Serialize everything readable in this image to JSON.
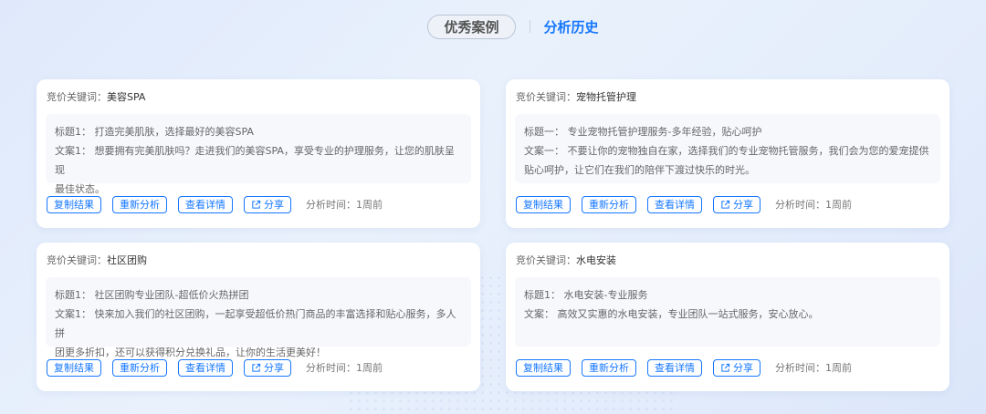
{
  "tabs": {
    "excellent_cases": "优秀案例",
    "analysis_history": "分析历史"
  },
  "cards": [
    {
      "keyword_label": "竞价关键词：",
      "keyword": "美容SPA",
      "title_label": "标题1：",
      "title": "打造完美肌肤，选择最好的美容SPA",
      "copy_label": "文案1：",
      "copy_line1": "想要拥有完美肌肤吗？走进我们的美容SPA，享受专业的护理服务，让您的肌肤呈现",
      "copy_line2": "最佳状态。",
      "copy_btn": "复制结果",
      "reanalyze_btn": "重新分析",
      "details_btn": "查看详情",
      "share_btn": "分享",
      "time": "分析时间：1周前"
    },
    {
      "keyword_label": "竞价关键词：",
      "keyword": "宠物托管护理",
      "title_label": "标题一：",
      "title": "专业宠物托管护理服务-多年经验，贴心呵护",
      "copy_label": "文案一：",
      "copy_line1": "不要让你的宠物独自在家，选择我们的专业宠物托管服务，我们会为您的爱宠提供",
      "copy_line2": "贴心呵护，让它们在我们的陪伴下渡过快乐的时光。",
      "copy_btn": "复制结果",
      "reanalyze_btn": "重新分析",
      "details_btn": "查看详情",
      "share_btn": "分享",
      "time": "分析时间：1周前"
    },
    {
      "keyword_label": "竞价关键词：",
      "keyword": "社区团购",
      "title_label": "标题1：",
      "title": "社区团购专业团队-超低价火热拼团",
      "copy_label": "文案1：",
      "copy_line1": "快来加入我们的社区团购，一起享受超低价热门商品的丰富选择和贴心服务，多人拼",
      "copy_line2": "团更多折扣，还可以获得积分兑换礼品，让你的生活更美好！",
      "copy_btn": "复制结果",
      "reanalyze_btn": "重新分析",
      "details_btn": "查看详情",
      "share_btn": "分享",
      "time": "分析时间：1周前"
    },
    {
      "keyword_label": "竞价关键词：",
      "keyword": "水电安装",
      "title_label": "标题1：",
      "title": "水电安装-专业服务",
      "copy_label": "文案：",
      "copy_line1": "高效又实惠的水电安装，专业团队一站式服务，安心放心。",
      "copy_line2": "",
      "copy_btn": "复制结果",
      "reanalyze_btn": "重新分析",
      "details_btn": "查看详情",
      "share_btn": "分享",
      "time": "分析时间：1周前"
    }
  ],
  "colors": {
    "accent": "#1677ff",
    "background": "#e4edfb",
    "card": "#ffffff"
  }
}
